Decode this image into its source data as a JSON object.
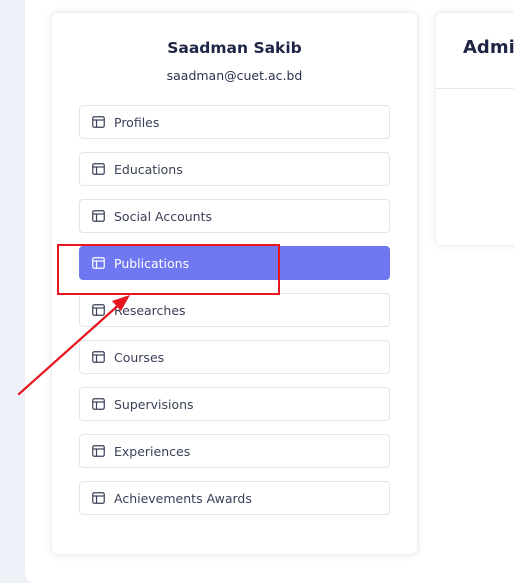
{
  "profile": {
    "name": "Saadman Sakib",
    "email": "saadman@cuet.ac.bd"
  },
  "menu": {
    "active_color": "#6f78f0",
    "items": [
      {
        "label": "Profiles",
        "icon": "table-icon"
      },
      {
        "label": "Educations",
        "icon": "table-icon"
      },
      {
        "label": "Social Accounts",
        "icon": "table-icon"
      },
      {
        "label": "Publications",
        "icon": "table-icon",
        "active": true
      },
      {
        "label": "Researches",
        "icon": "table-icon"
      },
      {
        "label": "Courses",
        "icon": "table-icon"
      },
      {
        "label": "Supervisions",
        "icon": "table-icon"
      },
      {
        "label": "Experiences",
        "icon": "table-icon"
      },
      {
        "label": "Achievements Awards",
        "icon": "table-icon"
      }
    ]
  },
  "admin_panel": {
    "title": "Admi"
  },
  "annotation": {
    "color": "#e8141e"
  }
}
